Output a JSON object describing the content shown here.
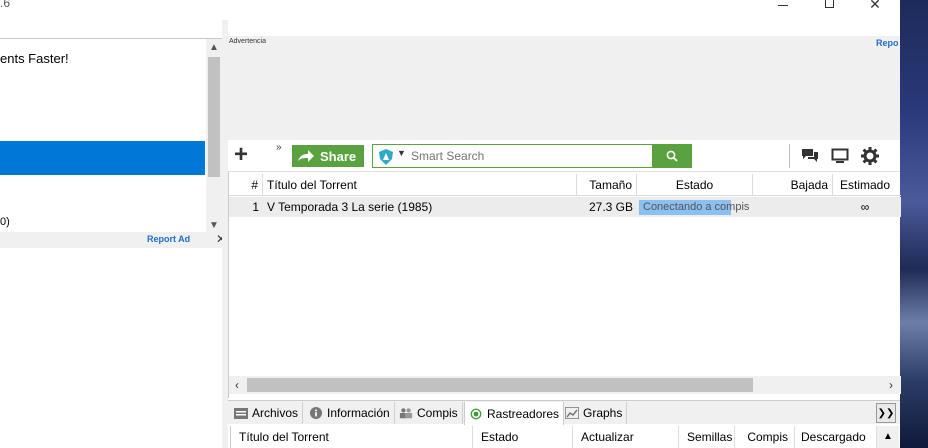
{
  "window": {
    "title_fragment": ".6",
    "close_glyph": "✕"
  },
  "sidebar": {
    "promo_text": "ents Faster!",
    "partial_text": "0)",
    "report_ad": "Report Ad",
    "close_glyph": "✕"
  },
  "ad": {
    "label": "Advertencia",
    "report": "Repo"
  },
  "toolbar": {
    "more_glyph": "»",
    "share_label": "Share",
    "search_placeholder": "Smart Search"
  },
  "torrents": {
    "columns": {
      "num": "#",
      "title": "Título del Torrent",
      "size": "Tamaño",
      "state": "Estado",
      "down": "Bajada",
      "est": "Estimado"
    },
    "rows": [
      {
        "num": "1",
        "title": "V Temporada 3 La serie (1985)",
        "size": "27.3 GB",
        "state": "Conectando a compis",
        "progress": 0.82,
        "down": "",
        "est": "∞"
      }
    ]
  },
  "tabs": [
    {
      "label": "Archivos",
      "icon": "files-icon"
    },
    {
      "label": "Información",
      "icon": "info-icon"
    },
    {
      "label": "Compis",
      "icon": "peers-icon"
    },
    {
      "label": "Rastreadores",
      "icon": "trackers-icon",
      "active": true
    },
    {
      "label": "Graphs",
      "icon": "graphs-icon"
    }
  ],
  "trackers": {
    "columns": {
      "title": "Título del Torrent",
      "estado": "Estado",
      "actualizar": "Actualizar",
      "semillas": "Semillas",
      "compis": "Compis",
      "descargado": "Descargado"
    }
  },
  "colors": {
    "accent_green": "#5aa13f",
    "selection_blue": "#0078d7",
    "progress_blue": "#8cc0f0",
    "link_blue": "#1f6fc9"
  }
}
